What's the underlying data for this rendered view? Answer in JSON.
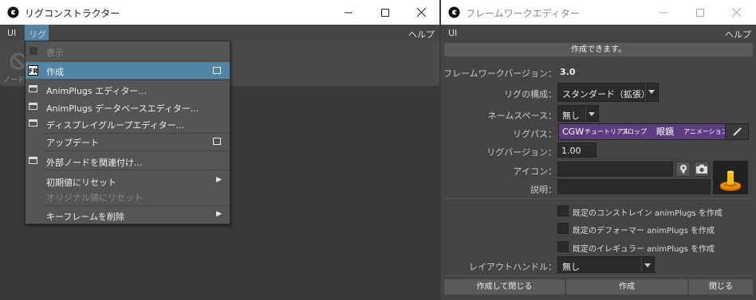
{
  "left_window": {
    "title": "リグコンストラクター",
    "menubar": {
      "ui": "UI",
      "rig": "リグ",
      "help": "ヘルプ"
    },
    "nodes_label": "ノード",
    "menu": [
      {
        "label": "表示",
        "icon": "checkbox",
        "disabled": true
      },
      {
        "label": "作成",
        "icon": "fr-icon",
        "selected": true,
        "option_box": true
      },
      {
        "label": "AnimPlugs エディター...",
        "icon": "window-icon"
      },
      {
        "label": "AnimPlugs データベースエディター...",
        "icon": "window-icon"
      },
      {
        "label": "ディスプレイグループエディター...",
        "icon": "window-icon"
      },
      {
        "label": "アップデート",
        "option_box": true
      },
      {
        "label": "外部ノードを関連付け...",
        "icon": "window-icon"
      },
      {
        "label": "初期値にリセット",
        "submenu": true
      },
      {
        "label": "オリジナル値にリセット",
        "disabled": true
      },
      {
        "label": "キーフレームを削除",
        "submenu": true
      }
    ],
    "fr_icon_text": "FR"
  },
  "right_window": {
    "title": "フレームワークエディター",
    "menubar": {
      "ui": "UI",
      "help": "ヘルプ"
    },
    "status": "作成できます。",
    "framework_version_label": "フレームワークバージョン：",
    "framework_version": "3.0",
    "rig_config_label": "リグの構成：",
    "rig_config_value": "スタンダード（拡張）",
    "namespace_label": "ネームスペース：",
    "namespace_value": "無し",
    "rigpath_label": "リグパス：",
    "rigpath_segments": [
      "CGW",
      "チュートリアル",
      "プロップ",
      "眼鏡",
      "アニメーション"
    ],
    "rig_version_label": "リグバージョン：",
    "rig_version_value": "1.00",
    "icon_label": "アイコン：",
    "desc_label": "説明：",
    "checkboxes": [
      "既定のコンストレイン animPlugs を作成",
      "既定のデフォーマー animPlugs を作成",
      "既定のイレギュラー animPlugs を作成"
    ],
    "layout_handle_label": "レイアウトハンドル：",
    "layout_handle_value": "無し",
    "buttons": {
      "create_close": "作成して閉じる",
      "create": "作成",
      "close": "閉じる"
    }
  },
  "colors": {
    "selection": "#5285a6",
    "rigpath": "#5b3d80",
    "preview_orange": "#f08a00"
  }
}
